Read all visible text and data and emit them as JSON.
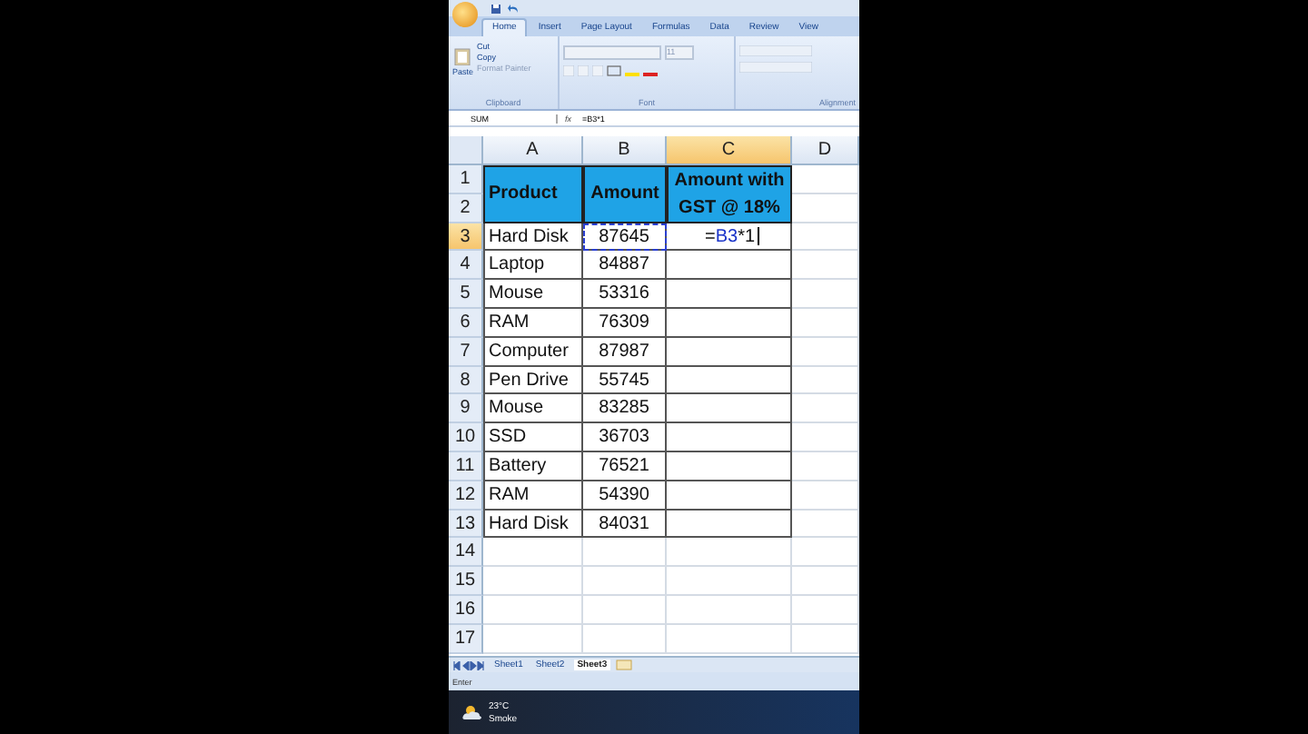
{
  "tabs": [
    {
      "label": "Home",
      "selected": true
    },
    {
      "label": "Insert",
      "selected": false
    },
    {
      "label": "Page Layout",
      "selected": false
    },
    {
      "label": "Formulas",
      "selected": false
    },
    {
      "label": "Data",
      "selected": false
    },
    {
      "label": "Review",
      "selected": false
    },
    {
      "label": "View",
      "selected": false
    }
  ],
  "ribbon": {
    "clipboard": {
      "paste": "Paste",
      "cut": "Cut",
      "copy": "Copy",
      "format_painter": "Format Painter",
      "label": "Clipboard"
    },
    "font": {
      "size": "11",
      "label": "Font"
    },
    "alignment": {
      "label": "Alignment"
    }
  },
  "formula_bar": {
    "name_box": "SUM",
    "function_label": "fx",
    "formula": "=B3*1"
  },
  "columns": [
    {
      "label": "A",
      "selected": false
    },
    {
      "label": "B",
      "selected": false
    },
    {
      "label": "C",
      "selected": true
    },
    {
      "label": "D",
      "selected": false
    }
  ],
  "header": {
    "rows": [
      "1",
      "2"
    ],
    "cells": [
      "Product",
      "Amount",
      "Amount with GST @ 18%"
    ]
  },
  "rows": [
    {
      "number": "3",
      "selected": true,
      "product": "Hard Disk",
      "amount": "87645",
      "editing": {
        "prefix": "=",
        "reference": "B3",
        "suffix": "*1"
      }
    },
    {
      "number": "4",
      "selected": false,
      "product": "Laptop",
      "amount": "84887"
    },
    {
      "number": "5",
      "selected": false,
      "product": "Mouse",
      "amount": "53316"
    },
    {
      "number": "6",
      "selected": false,
      "product": "RAM",
      "amount": "76309"
    },
    {
      "number": "7",
      "selected": false,
      "product": "Computer",
      "amount": "87987"
    },
    {
      "number": "8",
      "selected": false,
      "product": "Pen Drive",
      "amount": "55745"
    },
    {
      "number": "9",
      "selected": false,
      "product": "Mouse",
      "amount": "83285"
    },
    {
      "number": "10",
      "selected": false,
      "product": "SSD",
      "amount": "36703"
    },
    {
      "number": "11",
      "selected": false,
      "product": "Battery",
      "amount": "76521"
    },
    {
      "number": "12",
      "selected": false,
      "product": "RAM",
      "amount": "54390"
    },
    {
      "number": "13",
      "selected": false,
      "product": "Hard Disk",
      "amount": "84031"
    }
  ],
  "empty_rows": [
    "14",
    "15",
    "16",
    "17"
  ],
  "sheets": [
    {
      "label": "Sheet1",
      "selected": false
    },
    {
      "label": "Sheet2",
      "selected": false
    },
    {
      "label": "Sheet3",
      "selected": true
    }
  ],
  "status_bar": {
    "mode": "Enter"
  },
  "taskbar": {
    "temperature": "23°C",
    "condition": "Smoke"
  }
}
